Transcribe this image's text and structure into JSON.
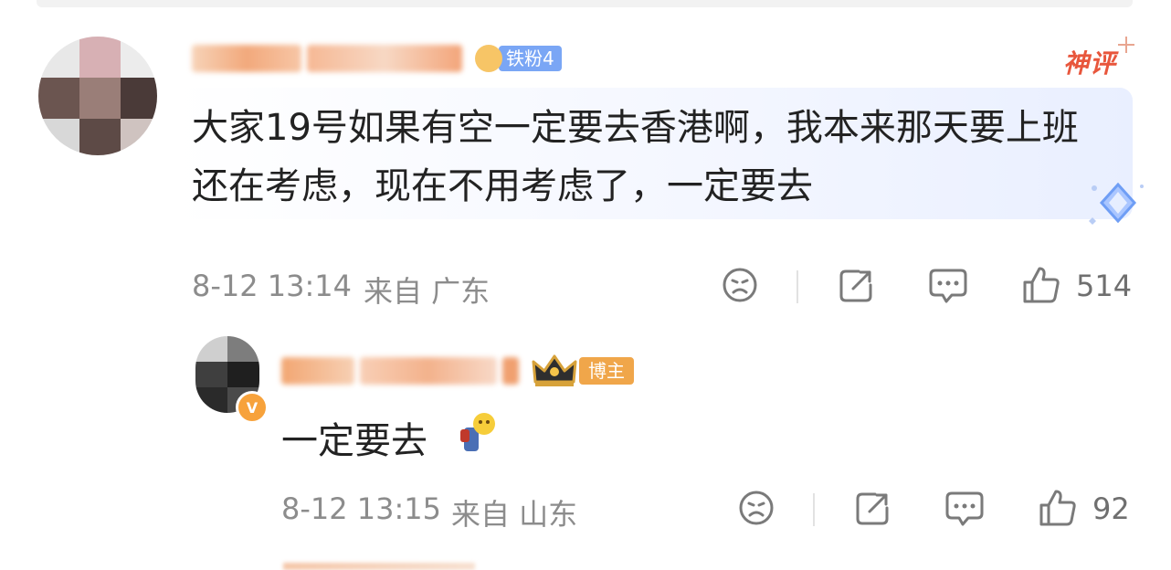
{
  "comment": {
    "badge_fan": "铁粉4",
    "badge_god": "神评",
    "text": "大家19号如果有空一定要去香港啊，我本来那天要上班还在考虑，现在不用考虑了，一定要去",
    "date": "8-12 13:14",
    "source": "来自 广东",
    "likes": "514"
  },
  "reply": {
    "badge_blogger": "博主",
    "verified_icon": "v-verified-icon",
    "text": "一定要去",
    "date": "8-12 13:15",
    "source": "来自 山东",
    "likes": "92"
  },
  "icons": {
    "dislike": "frown-face-icon",
    "share": "share-icon",
    "reply": "comment-bubble-icon",
    "like": "thumbs-up-icon"
  },
  "colors": {
    "god_comment_red": "#e8563c",
    "fan_badge_blue": "#7aa6f5",
    "blogger_badge_orange": "#f0a64a",
    "username_orange": "#f29a5c",
    "meta_gray": "#8c8c8c"
  }
}
